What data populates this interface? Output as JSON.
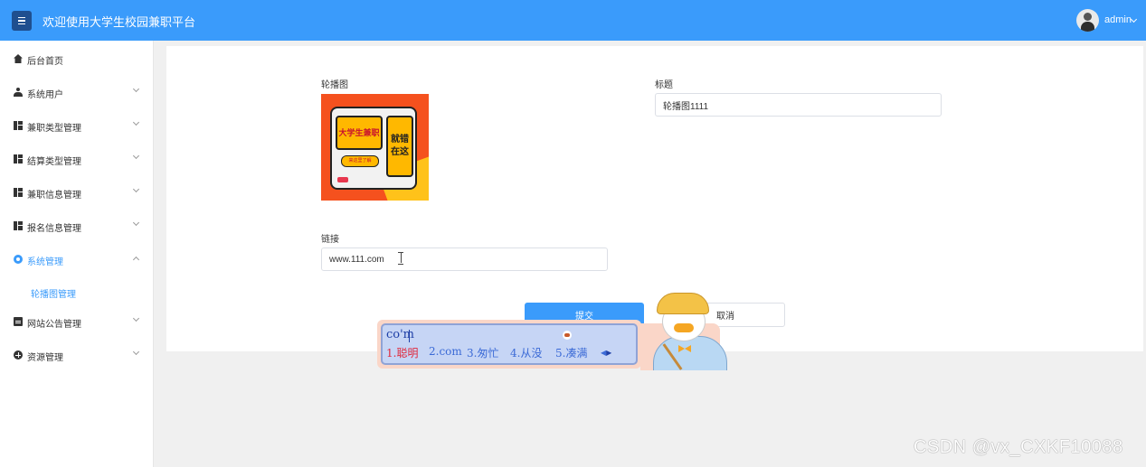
{
  "header": {
    "title": "欢迎使用大学生校园兼职平台",
    "user": "admin"
  },
  "sidebar": {
    "items": [
      {
        "label": "后台首页",
        "icon": "home-icon"
      },
      {
        "label": "系统用户",
        "icon": "user-icon"
      },
      {
        "label": "兼职类型管理",
        "icon": "grid-icon"
      },
      {
        "label": "结算类型管理",
        "icon": "grid-icon"
      },
      {
        "label": "兼职信息管理",
        "icon": "grid-icon"
      },
      {
        "label": "报名信息管理",
        "icon": "grid-icon"
      },
      {
        "label": "系统管理",
        "icon": "gear-icon",
        "expanded": true
      },
      {
        "label": "网站公告管理",
        "icon": "document-icon"
      },
      {
        "label": "资源管理",
        "icon": "plus-circle-icon"
      }
    ],
    "sub_item": "轮播图管理"
  },
  "form": {
    "image_label": "轮播图",
    "banner": {
      "panel1": "大学生兼职",
      "panel2": "就错 在这",
      "tag": "来这里了解"
    },
    "title_label": "标题",
    "title_value": "轮播图1111",
    "link_label": "链接",
    "link_value": "www.111.com",
    "submit_label": "提交",
    "cancel_label": "取消"
  },
  "ime": {
    "composition": "co'm",
    "candidates": [
      "1.聪明",
      "2.com",
      "3.匆忙",
      "4.从没",
      "5.凑满"
    ]
  },
  "watermark": "CSDN @vx_CXKF10088",
  "colors": {
    "primary": "#3a9bfb",
    "sidebar_bg": "#ffffff",
    "page_bg": "#f0f0f0"
  }
}
